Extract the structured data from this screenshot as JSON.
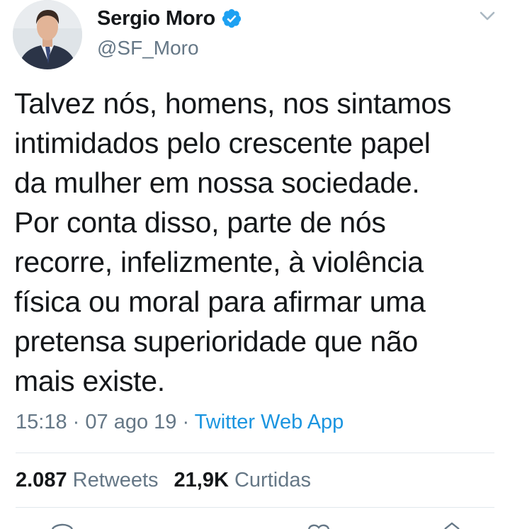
{
  "author": {
    "display_name": "Sergio Moro",
    "handle": "@SF_Moro",
    "verified": true
  },
  "tweet": {
    "text": "Talvez nós, homens, nos sintamos\nintimidados pelo crescente papel\nda mulher em nossa sociedade.\nPor conta disso, parte de nós\nrecorre, infelizmente, à violência\nfísica ou moral para afirmar uma\npretensa superioridade que não\nmais existe.",
    "time": "15:18",
    "date": "07 ago 19",
    "separator": "·",
    "source": "Twitter Web App"
  },
  "stats": {
    "retweets_count": "2.087",
    "retweets_label": "Retweets",
    "likes_count": "21,9K",
    "likes_label": "Curtidas"
  },
  "icons": {
    "verified": "verified-badge-icon",
    "caret": "chevron-down-icon"
  },
  "colors": {
    "text": "#14171a",
    "secondary": "#657786",
    "link": "#1b95e0",
    "verified": "#1da1f2",
    "divider": "#e1e8ed"
  }
}
